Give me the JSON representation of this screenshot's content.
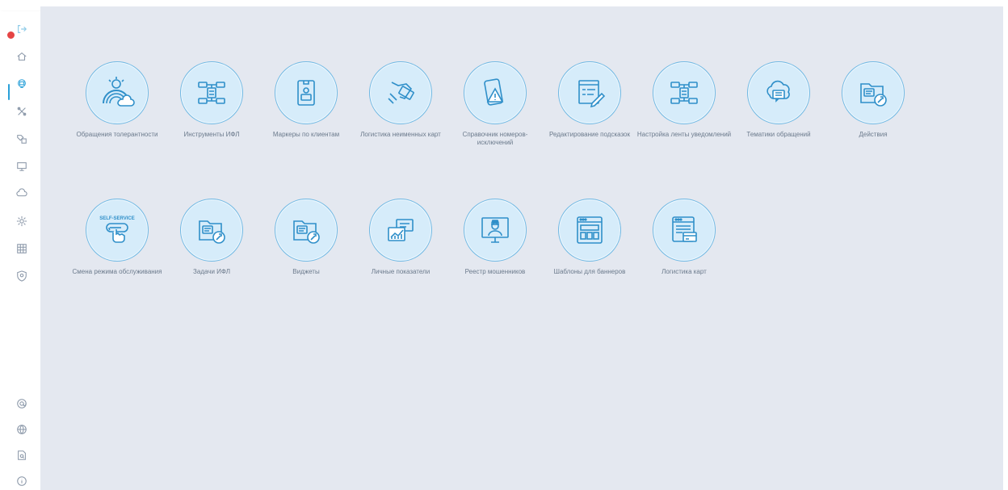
{
  "sidebar": {
    "items": [
      {
        "name": "logout-icon"
      },
      {
        "name": "home-icon"
      },
      {
        "name": "support-icon"
      },
      {
        "name": "tools-icon"
      },
      {
        "name": "tags-icon"
      },
      {
        "name": "monitor-icon"
      },
      {
        "name": "cloud-icon"
      },
      {
        "name": "settings-icon"
      },
      {
        "name": "table-icon"
      },
      {
        "name": "shield-icon"
      }
    ],
    "bottom_items": [
      {
        "name": "at-sign-icon"
      },
      {
        "name": "globe-icon"
      },
      {
        "name": "document-search-icon"
      },
      {
        "name": "info-icon"
      }
    ]
  },
  "tiles": [
    {
      "label": "Обращения толерантности",
      "icon": "rainbow-cloud-icon"
    },
    {
      "label": "Инструменты ИФЛ",
      "icon": "structure-icon"
    },
    {
      "label": "Маркеры по клиентам",
      "icon": "client-badge-icon"
    },
    {
      "label": "Логистика неименных карт",
      "icon": "card-hand-icon"
    },
    {
      "label": "Справочник номеров-исключений",
      "icon": "phone-warning-icon"
    },
    {
      "label": "Редактирование подсказок",
      "icon": "edit-document-icon"
    },
    {
      "label": "Настройка ленты уведомлений",
      "icon": "structure-icon"
    },
    {
      "label": "Тематики обращений",
      "icon": "chat-cloud-icon"
    },
    {
      "label": "Действия",
      "icon": "folder-wrench-icon"
    },
    {
      "label": "Смена режима обслуживания",
      "icon": "self-service-icon",
      "badge": "SELF-SERVICE"
    },
    {
      "label": "Задачи ИФЛ",
      "icon": "folder-wrench-icon"
    },
    {
      "label": "Виджеты",
      "icon": "folder-wrench-icon"
    },
    {
      "label": "Личные показатели",
      "icon": "chart-growth-icon"
    },
    {
      "label": "Реестр мошенников",
      "icon": "fraudster-monitor-icon"
    },
    {
      "label": "Шаблоны для баннеров",
      "icon": "banner-template-icon"
    },
    {
      "label": "Логистика карт",
      "icon": "card-list-icon"
    }
  ],
  "colors": {
    "accent": "#2aa0d8",
    "circle_fill": "#d6ecfa",
    "circle_border": "#6fb8e3",
    "icon_stroke": "#2f8fc9",
    "background": "#e4e8f0",
    "badge": "#e54545"
  }
}
